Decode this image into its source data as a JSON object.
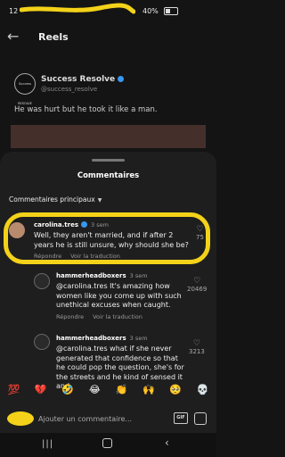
{
  "status": {
    "time": "12",
    "battery": "40%"
  },
  "header": {
    "back_icon": "arrow-left-icon",
    "title": "Reels"
  },
  "post": {
    "avatar_text": "Success RESOLVE",
    "author": "Success Resolve",
    "handle": "@success_resolve",
    "caption": "He was hurt but he took it like a man."
  },
  "sheet": {
    "title": "Commentaires",
    "sort_label": "Commentaires principaux"
  },
  "comments": [
    {
      "user": "carolina.tres",
      "time": "3 sem",
      "text": "Well, they aren't married, and if after 2 years he is still unsure, why should she be?",
      "reply": "Répondre",
      "translate": "Voir la traduction",
      "likes": "75"
    },
    {
      "user": "hammerheadboxers",
      "time": "3 sem",
      "text": "@carolina.tres It's amazing how women like you come up with such unethical excuses when caught.",
      "reply": "Répondre",
      "translate": "Voir la traduction",
      "likes": "20469"
    },
    {
      "user": "hammerheadboxers",
      "time": "3 sem",
      "text": "@carolina.tres what if she never generated that confidence so that he could pop the question, she's for the streets and he kind of sensed it and",
      "likes": "3213"
    }
  ],
  "emojis": [
    "💯",
    "💔",
    "🤣",
    "😂",
    "👏",
    "🙌",
    "🥺",
    "💀"
  ],
  "composer": {
    "placeholder": "Ajouter un commentaire...",
    "gif": "GIF"
  },
  "colors": {
    "highlight": "#f3d219",
    "background": "#141414",
    "sheet": "#1e1e1e",
    "verified": "#3897f0"
  }
}
